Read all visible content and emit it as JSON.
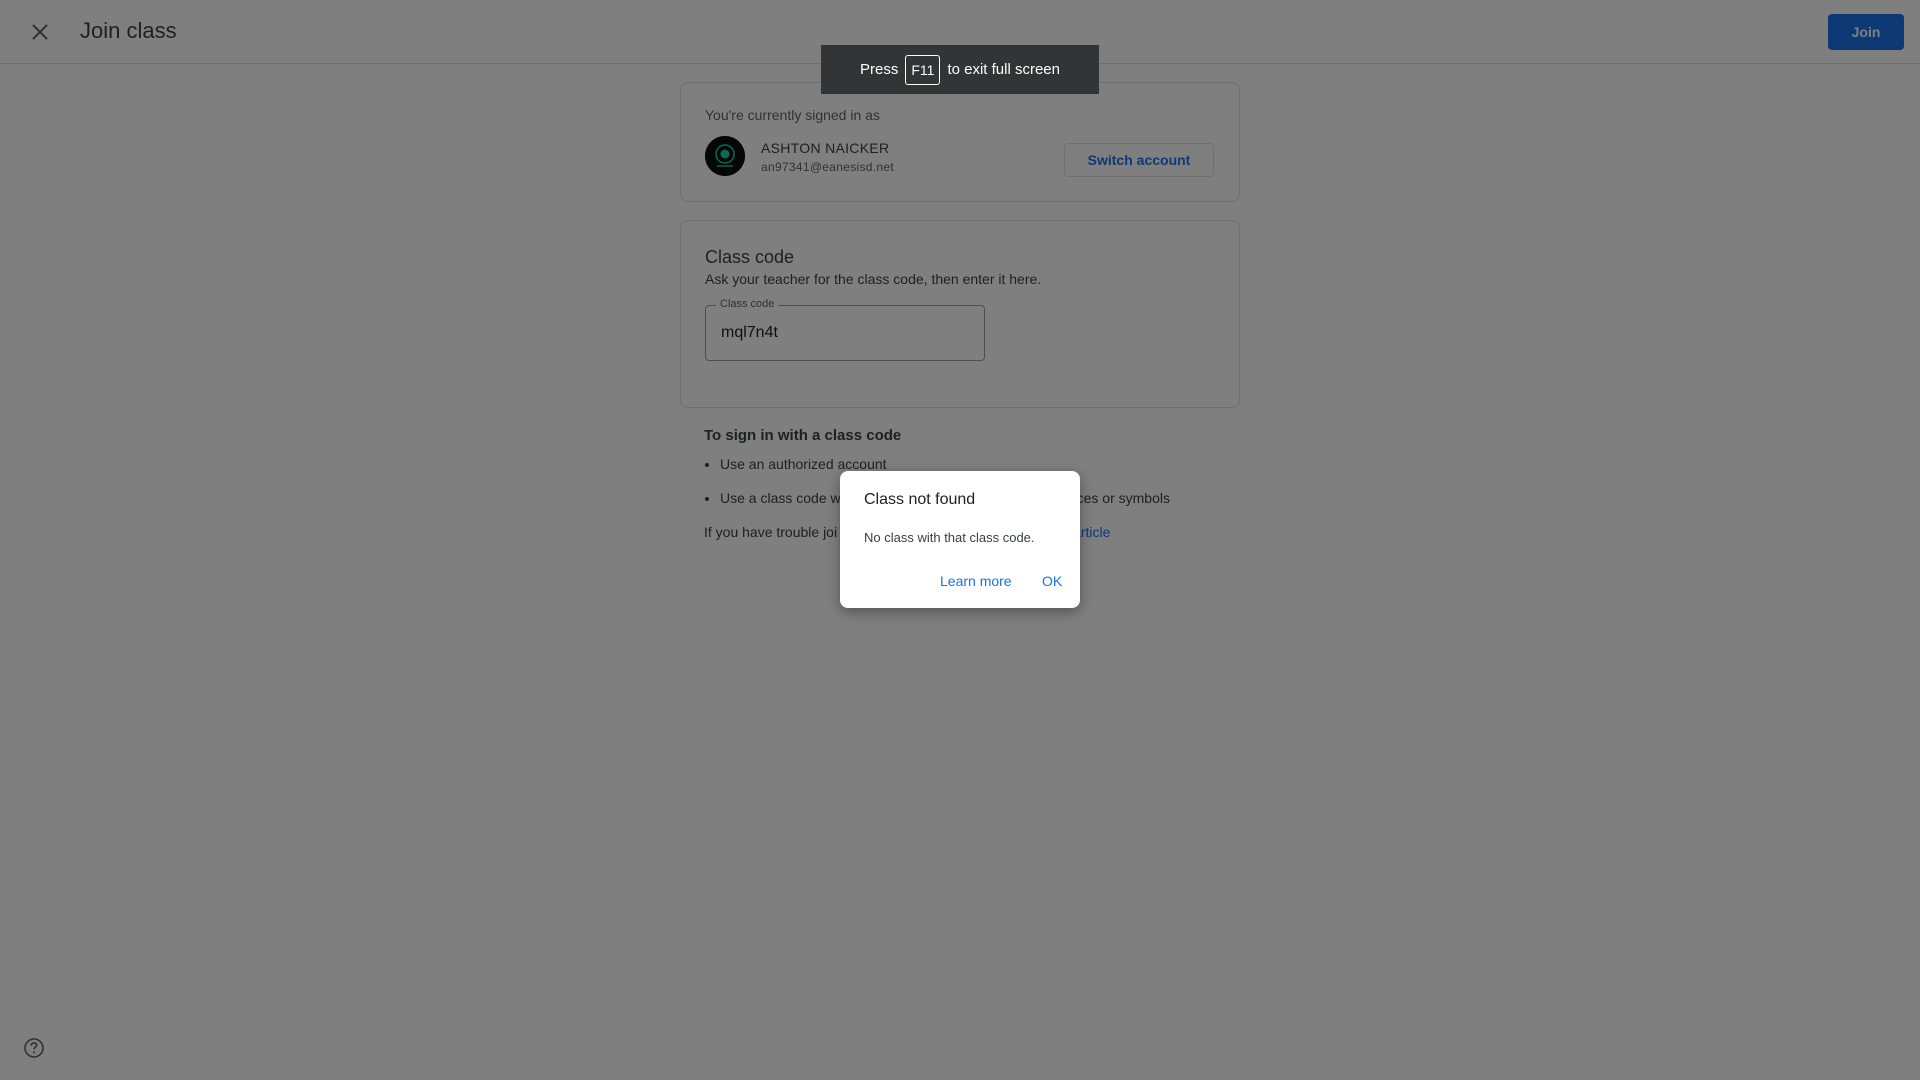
{
  "header": {
    "title": "Join class",
    "join_label": "Join"
  },
  "account": {
    "heading": "You're currently signed in as",
    "name": "ASHTON NAICKER",
    "email": "an97341@eanesisd.net",
    "switch_label": "Switch account"
  },
  "class_code": {
    "title": "Class code",
    "description": "Ask your teacher for the class code, then enter it here.",
    "field_label": "Class code",
    "field_value": "mql7n4t"
  },
  "instructions": {
    "title": "To sign in with a class code",
    "items": [
      "Use an authorized account",
      "Use a class code w",
      "ces or symbols"
    ],
    "trouble_text": "If you have trouble joi",
    "trouble_link": "article"
  },
  "fullscreen_toast": {
    "before": "Press",
    "key": "F11",
    "after": "to exit full screen"
  },
  "dialog": {
    "title": "Class not found",
    "body": "No class with that class code.",
    "learn_more": "Learn more",
    "ok": "OK"
  },
  "icons": {
    "close": "close-icon",
    "help": "help-icon"
  },
  "colors": {
    "accent": "#1a73e8",
    "scrim": "rgba(0,0,0,0.5)",
    "toast": "#323436"
  }
}
